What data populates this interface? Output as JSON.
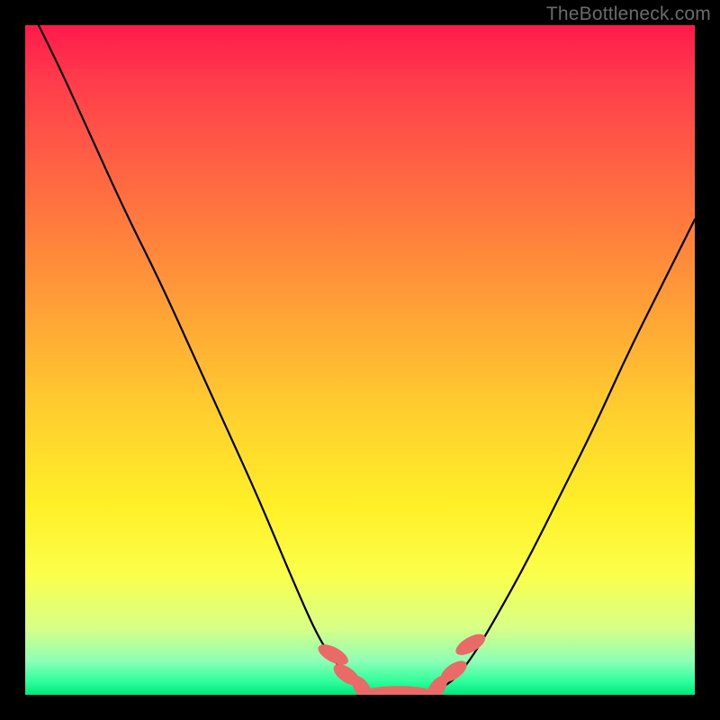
{
  "watermark": "TheBottleneck.com",
  "colors": {
    "curve": "#000000",
    "marker_fill": "#e96a66",
    "marker_stroke": "#c24d48"
  },
  "chart_data": {
    "type": "line",
    "title": "",
    "xlabel": "",
    "ylabel": "",
    "xlim": [
      0,
      1
    ],
    "ylim": [
      0,
      1
    ],
    "series": [
      {
        "name": "bottleneck-curve",
        "x": [
          0.0,
          0.05,
          0.1,
          0.15,
          0.2,
          0.25,
          0.3,
          0.35,
          0.4,
          0.44,
          0.47,
          0.5,
          0.55,
          0.6,
          0.64,
          0.67,
          0.7,
          0.75,
          0.8,
          0.85,
          0.9,
          0.95,
          1.0
        ],
        "y": [
          1.04,
          0.94,
          0.83,
          0.72,
          0.62,
          0.51,
          0.4,
          0.29,
          0.17,
          0.08,
          0.04,
          0.01,
          0.0,
          0.0,
          0.02,
          0.06,
          0.11,
          0.2,
          0.3,
          0.4,
          0.51,
          0.61,
          0.71
        ]
      }
    ],
    "markers": [
      {
        "cx": 0.46,
        "cy": 0.06,
        "r": 0.017,
        "angle": -62
      },
      {
        "cx": 0.48,
        "cy": 0.03,
        "r": 0.015,
        "angle": -55
      },
      {
        "cx": 0.503,
        "cy": 0.01,
        "r": 0.014,
        "angle": -35
      },
      {
        "cx": 0.557,
        "cy": 0.0,
        "r": 0.06,
        "angle": 0,
        "elongated": true
      },
      {
        "cx": 0.615,
        "cy": 0.01,
        "r": 0.014,
        "angle": 35
      },
      {
        "cx": 0.64,
        "cy": 0.035,
        "r": 0.015,
        "angle": 55
      },
      {
        "cx": 0.665,
        "cy": 0.075,
        "r": 0.017,
        "angle": 60
      }
    ]
  }
}
